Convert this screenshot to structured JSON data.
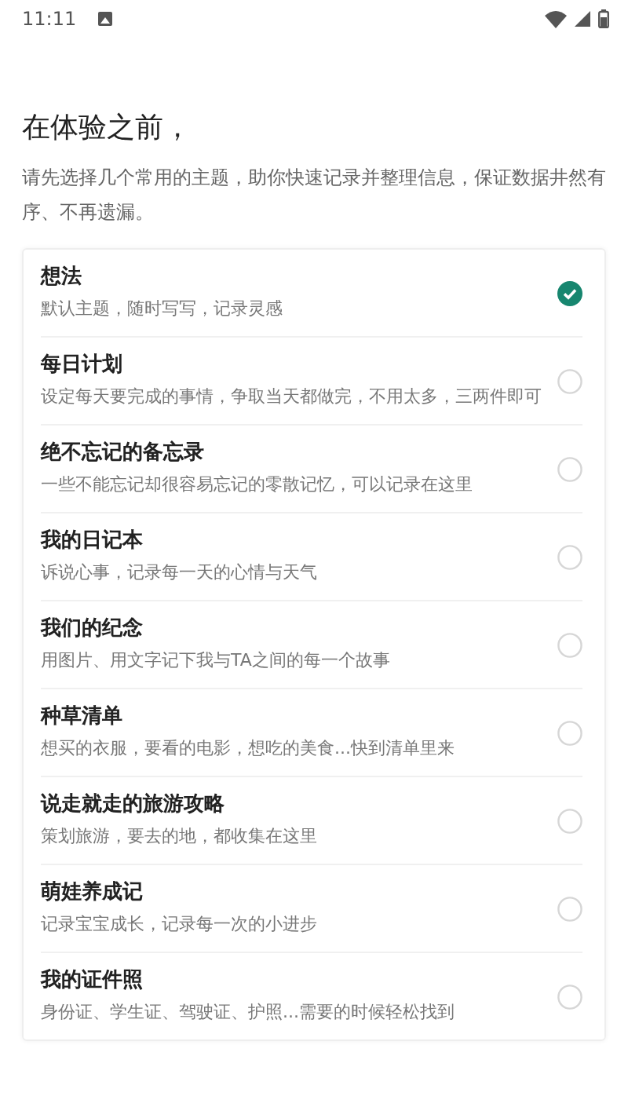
{
  "status_bar": {
    "time": "11:11"
  },
  "heading": "在体验之前，",
  "intro": "请先选择几个常用的主题，助你快速记录并整理信息，保证数据井然有序、不再遗漏。",
  "topics": [
    {
      "title": "想法",
      "description": "默认主题，随时写写，记录灵感",
      "selected": true
    },
    {
      "title": "每日计划",
      "description": "设定每天要完成的事情，争取当天都做完，不用太多，三两件即可",
      "selected": false
    },
    {
      "title": "绝不忘记的备忘录",
      "description": "一些不能忘记却很容易忘记的零散记忆，可以记录在这里",
      "selected": false
    },
    {
      "title": "我的日记本",
      "description": "诉说心事，记录每一天的心情与天气",
      "selected": false
    },
    {
      "title": "我们的纪念",
      "description": "用图片、用文字记下我与TA之间的每一个故事",
      "selected": false
    },
    {
      "title": "种草清单",
      "description": "想买的衣服，要看的电影，想吃的美食...快到清单里来",
      "selected": false
    },
    {
      "title": "说走就走的旅游攻略",
      "description": "策划旅游，要去的地，都收集在这里",
      "selected": false
    },
    {
      "title": "萌娃养成记",
      "description": "记录宝宝成长，记录每一次的小进步",
      "selected": false
    },
    {
      "title": "我的证件照",
      "description": "身份证、学生证、驾驶证、护照...需要的时候轻松找到",
      "selected": false
    }
  ]
}
